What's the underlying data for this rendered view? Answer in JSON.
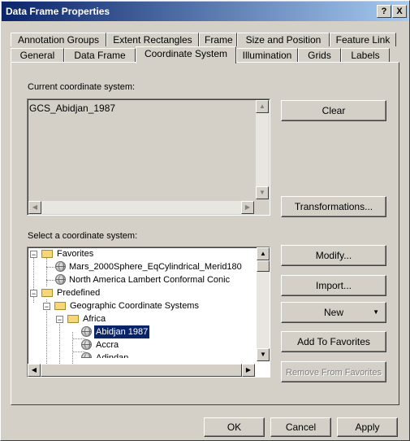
{
  "window": {
    "title": "Data Frame Properties",
    "help_label": "?",
    "close_label": "X"
  },
  "tabs_row1": [
    {
      "label": "Annotation Groups"
    },
    {
      "label": "Extent Rectangles"
    },
    {
      "label": "Frame"
    },
    {
      "label": "Size and Position"
    },
    {
      "label": "Feature Link"
    }
  ],
  "tabs_row2": [
    {
      "label": "General"
    },
    {
      "label": "Data Frame"
    },
    {
      "label": "Coordinate System"
    },
    {
      "label": "Illumination"
    },
    {
      "label": "Grids"
    },
    {
      "label": "Labels"
    }
  ],
  "active_tab": "Coordinate System",
  "current_cs": {
    "label": "Current coordinate system:",
    "value": "GCS_Abidjan_1987",
    "clear_label": "Clear",
    "transformations_label": "Transformations..."
  },
  "select_cs": {
    "label": "Select a coordinate system:",
    "tree": [
      {
        "text": "Favorites",
        "type": "folder",
        "expander": "−"
      },
      {
        "text": "Mars_2000Sphere_EqCylindrical_Merid180",
        "type": "globe"
      },
      {
        "text": "North America Lambert Conformal Conic",
        "type": "globe"
      },
      {
        "text": "Predefined",
        "type": "folder",
        "expander": "−"
      },
      {
        "text": "Geographic Coordinate Systems",
        "type": "folder",
        "expander": "−"
      },
      {
        "text": "Africa",
        "type": "folder",
        "expander": "−"
      },
      {
        "text": "Abidjan 1987",
        "type": "globe",
        "selected": true
      },
      {
        "text": "Accra",
        "type": "globe"
      },
      {
        "text": "Adindan",
        "type": "globe"
      }
    ],
    "modify_label": "Modify...",
    "import_label": "Import...",
    "new_label": "New",
    "add_favorites_label": "Add To Favorites",
    "remove_favorites_label": "Remove From Favorites"
  },
  "footer": {
    "ok_label": "OK",
    "cancel_label": "Cancel",
    "apply_label": "Apply"
  },
  "colors": {
    "titlebar_start": "#0a246a",
    "titlebar_end": "#a6caf0",
    "face": "#d4d0c8",
    "selection": "#0a246a"
  },
  "icons": {
    "folder": "folder-icon",
    "globe": "globe-icon",
    "dropdown": "triangle-down-icon"
  }
}
